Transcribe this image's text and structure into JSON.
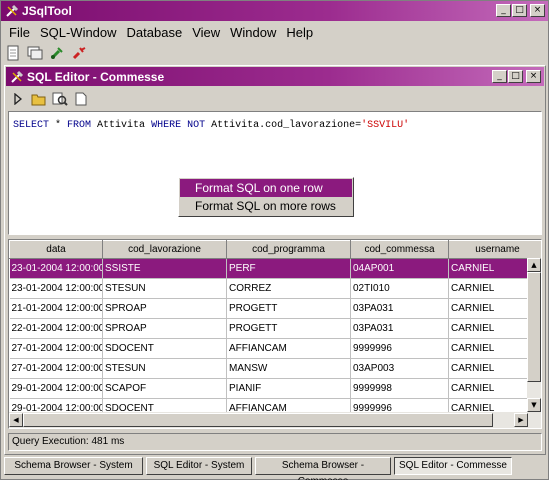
{
  "app": {
    "title": "JSqlTool"
  },
  "menubar": {
    "items": [
      "File",
      "SQL-Window",
      "Database",
      "View",
      "Window",
      "Help"
    ]
  },
  "editor": {
    "title": "SQL Editor - Commesse",
    "sql": {
      "kw1": "SELECT",
      "p1": " * ",
      "kw2": "FROM",
      "p2": " Attivita ",
      "kw3": "WHERE NOT",
      "p3": " Attivita.cod_lavorazione=",
      "str": "'SSVILU'"
    },
    "context_menu": [
      "Format SQL on one row",
      "Format SQL on more rows"
    ],
    "status": "Query Execution: 481 ms"
  },
  "table": {
    "columns": [
      "data",
      "cod_lavorazione",
      "cod_programma",
      "cod_commessa",
      "username"
    ],
    "rows": [
      [
        "23-01-2004 12:00:00",
        "SSISTE",
        "PERF",
        "04AP001",
        "CARNIEL"
      ],
      [
        "23-01-2004 12:00:00",
        "STESUN",
        "CORREZ",
        "02TI010",
        "CARNIEL"
      ],
      [
        "21-01-2004 12:00:00",
        "SPROAP",
        "PROGETT",
        "03PA031",
        "CARNIEL"
      ],
      [
        "22-01-2004 12:00:00",
        "SPROAP",
        "PROGETT",
        "03PA031",
        "CARNIEL"
      ],
      [
        "27-01-2004 12:00:00",
        "SDOCENT",
        "AFFIANCAM",
        "9999996",
        "CARNIEL"
      ],
      [
        "27-01-2004 12:00:00",
        "STESUN",
        "MANSW",
        "03AP003",
        "CARNIEL"
      ],
      [
        "29-01-2004 12:00:00",
        "SCAPOF",
        "PIANIF",
        "9999998",
        "CARNIEL"
      ],
      [
        "29-01-2004 12:00:00",
        "SDOCENT",
        "AFFIANCAM",
        "9999996",
        "CARNIEL"
      ]
    ]
  },
  "tasks": [
    {
      "label": "Schema Browser - System",
      "active": false
    },
    {
      "label": "SQL Editor - System",
      "active": false
    },
    {
      "label": "Schema Browser - Commesse",
      "active": false
    },
    {
      "label": "SQL Editor - Commesse",
      "active": true
    }
  ],
  "colors": {
    "title_bar": "#8b1a7e",
    "selection": "#8b1a7e",
    "sql_keyword": "#00008b",
    "sql_string": "#cc0000"
  },
  "icons": [
    "tools-icon",
    "new-document-icon",
    "window-icon",
    "connect-icon",
    "disconnect-icon",
    "run-icon",
    "open-icon",
    "search-icon",
    "page-icon",
    "minimize-icon",
    "maximize-icon",
    "close-icon"
  ]
}
